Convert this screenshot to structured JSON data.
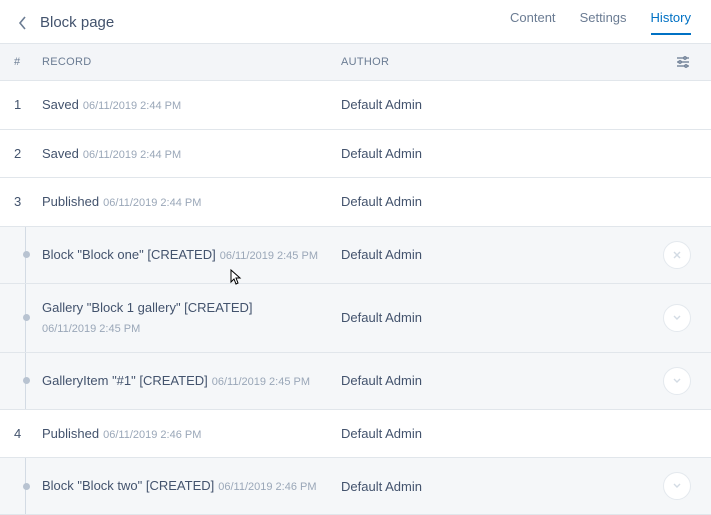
{
  "header": {
    "title": "Block page",
    "tabs": [
      {
        "label": "Content",
        "active": false
      },
      {
        "label": "Settings",
        "active": false
      },
      {
        "label": "History",
        "active": true
      }
    ]
  },
  "columns": {
    "num": "#",
    "record": "RECORD",
    "author": "AUTHOR"
  },
  "rows": [
    {
      "kind": "main",
      "num": "1",
      "title": "Saved",
      "ts": "06/11/2019 2:44 PM",
      "author": "Default Admin",
      "action": null
    },
    {
      "kind": "main",
      "num": "2",
      "title": "Saved",
      "ts": "06/11/2019 2:44 PM",
      "author": "Default Admin",
      "action": null
    },
    {
      "kind": "main",
      "num": "3",
      "title": "Published",
      "ts": "06/11/2019 2:44 PM",
      "author": "Default Admin",
      "action": null
    },
    {
      "kind": "sub",
      "title": "Block \"Block one\" [CREATED]",
      "ts": "06/11/2019 2:45 PM",
      "author": "Default Admin",
      "action": "close"
    },
    {
      "kind": "sub",
      "title": "Gallery \"Block 1 gallery\" [CREATED]",
      "ts": "06/11/2019 2:45 PM",
      "author": "Default Admin",
      "action": "chevron"
    },
    {
      "kind": "sub",
      "title": "GalleryItem \"#1\" [CREATED]",
      "ts": "06/11/2019 2:45 PM",
      "author": "Default Admin",
      "action": "chevron"
    },
    {
      "kind": "main",
      "num": "4",
      "title": "Published",
      "ts": "06/11/2019 2:46 PM",
      "author": "Default Admin",
      "action": null
    },
    {
      "kind": "sub",
      "title": "Block \"Block two\" [CREATED]",
      "ts": "06/11/2019 2:46 PM",
      "author": "Default Admin",
      "action": "chevron"
    }
  ]
}
